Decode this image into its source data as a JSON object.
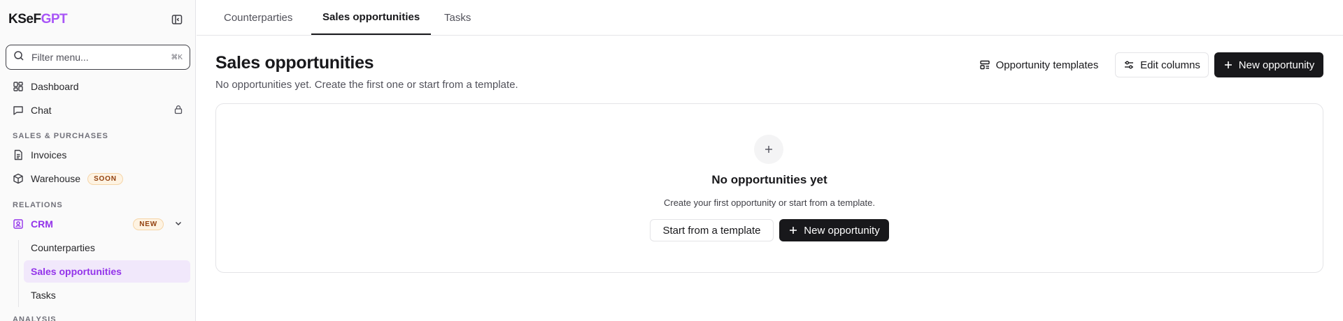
{
  "app": {
    "logo_primary": "KSeF",
    "logo_accent": "GPT",
    "accent_color": "#a855f7"
  },
  "sidebar": {
    "filter": {
      "placeholder": "Filter menu...",
      "shortcut": "⌘K"
    },
    "items": [
      {
        "label": "Dashboard",
        "icon": "dashboard-icon"
      },
      {
        "label": "Chat",
        "icon": "chat-icon",
        "trailing_icon": "lock-icon"
      }
    ],
    "sections": [
      {
        "label": "SALES & PURCHASES",
        "items": [
          {
            "label": "Invoices",
            "icon": "invoice-icon"
          },
          {
            "label": "Warehouse",
            "icon": "box-icon",
            "badge": "SOON"
          }
        ]
      },
      {
        "label": "RELATIONS",
        "items": [
          {
            "label": "CRM",
            "icon": "contact-icon",
            "badge": "NEW",
            "expanded": true,
            "children": [
              {
                "label": "Counterparties"
              },
              {
                "label": "Sales opportunities",
                "active": true
              },
              {
                "label": "Tasks"
              }
            ]
          }
        ]
      },
      {
        "label": "ANALYSIS",
        "items": []
      }
    ]
  },
  "tabs": [
    {
      "label": "Counterparties"
    },
    {
      "label": "Sales opportunities",
      "active": true
    },
    {
      "label": "Tasks"
    }
  ],
  "header": {
    "title": "Sales opportunities",
    "subtitle": "No opportunities yet. Create the first one or start from a template.",
    "actions": {
      "templates": "Opportunity templates",
      "edit_columns": "Edit columns",
      "new_opportunity": "New opportunity"
    }
  },
  "empty_state": {
    "title": "No opportunities yet",
    "description": "Create your first opportunity or start from a template.",
    "template_button": "Start from a template",
    "new_button": "New opportunity"
  }
}
